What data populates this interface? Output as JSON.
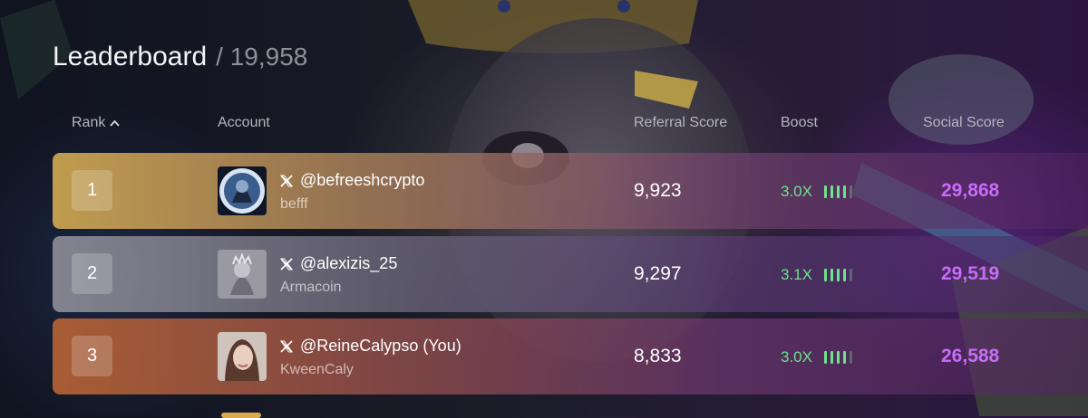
{
  "header": {
    "title": "Leaderboard",
    "count_text": "/ 19,958"
  },
  "columns": {
    "rank": "Rank",
    "account": "Account",
    "referral_score": "Referral Score",
    "boost": "Boost",
    "social_score": "Social Score"
  },
  "rows": [
    {
      "rank": "1",
      "handle": "@befreeshcrypto",
      "display_name": "befff",
      "referral_score": "9,923",
      "boost": "3.0X",
      "boost_level": 4,
      "social_score": "29,868",
      "row_color": "#c9a350"
    },
    {
      "rank": "2",
      "handle": "@alexizis_25",
      "display_name": "Armacoin",
      "referral_score": "9,297",
      "boost": "3.1X",
      "boost_level": 4,
      "social_score": "29,519",
      "row_color": "#8c8c96"
    },
    {
      "rank": "3",
      "handle": "@ReineCalypso (You)",
      "display_name": "KweenCaly",
      "referral_score": "8,833",
      "boost": "3.0X",
      "boost_level": 4,
      "social_score": "26,588",
      "row_color": "#b06034"
    }
  ],
  "colors": {
    "boost_green": "#6ee28c",
    "social_purple": "#c66cf6"
  },
  "icons": {
    "sort": "chevron-up-icon",
    "platform": "x-logo-icon"
  }
}
